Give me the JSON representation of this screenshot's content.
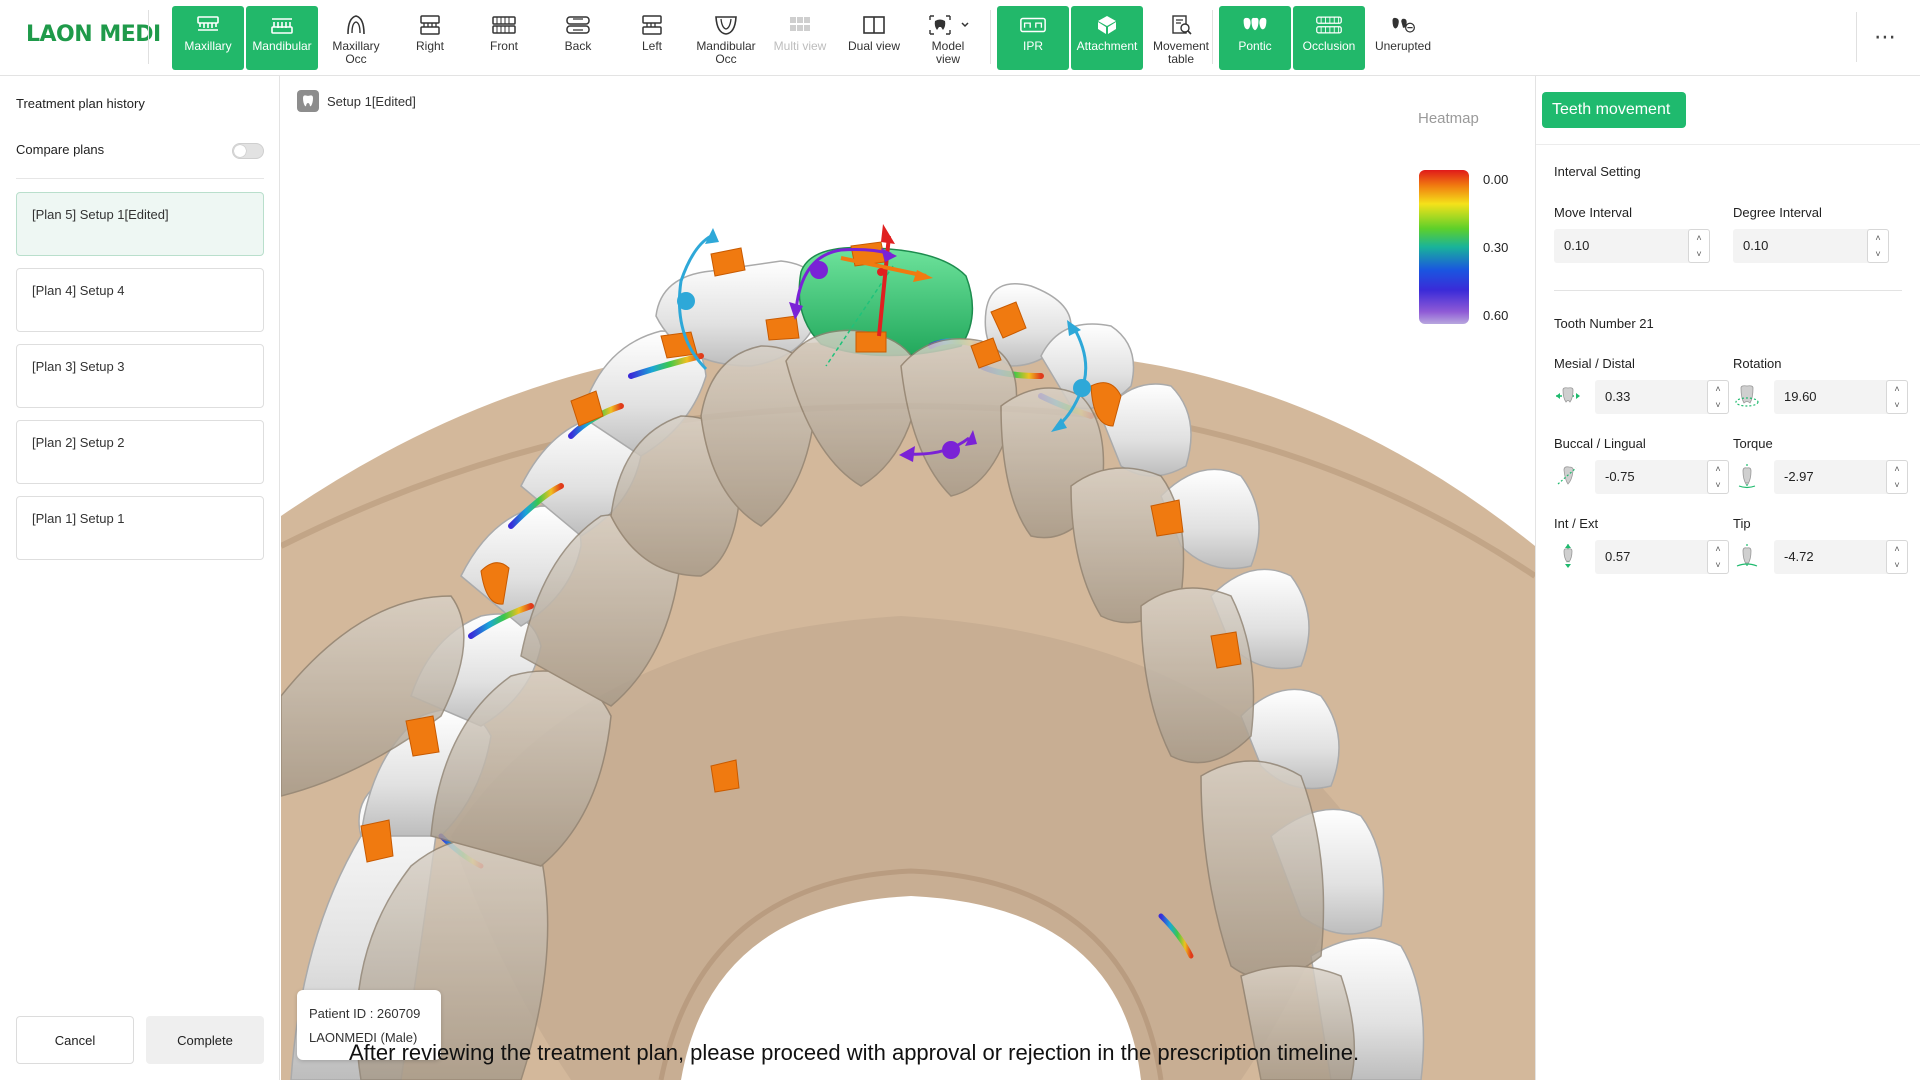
{
  "app": {
    "logo": "LAON MEDI"
  },
  "toolbar": {
    "buttons": [
      {
        "id": "maxillary",
        "label": "Maxillary",
        "active": true
      },
      {
        "id": "mandibular",
        "label": "Mandibular",
        "active": true
      },
      {
        "id": "maxillary-occ",
        "label": "Maxillary\nOcc",
        "active": false
      },
      {
        "id": "right",
        "label": "Right",
        "active": false
      },
      {
        "id": "front",
        "label": "Front",
        "active": false
      },
      {
        "id": "back",
        "label": "Back",
        "active": false
      },
      {
        "id": "left",
        "label": "Left",
        "active": false
      },
      {
        "id": "mandibular-occ",
        "label": "Mandibular\nOcc",
        "active": false
      },
      {
        "id": "multi-view",
        "label": "Multi view",
        "active": false,
        "disabled": true
      },
      {
        "id": "dual-view",
        "label": "Dual view",
        "active": false
      },
      {
        "id": "model-view",
        "label": "Model\nview",
        "active": false
      },
      {
        "id": "ipr",
        "label": "IPR",
        "active": true
      },
      {
        "id": "attachment",
        "label": "Attachment",
        "active": true
      },
      {
        "id": "movement-table",
        "label": "Movement\ntable",
        "active": false
      },
      {
        "id": "pontic",
        "label": "Pontic",
        "active": true
      },
      {
        "id": "occlusion",
        "label": "Occlusion",
        "active": true
      },
      {
        "id": "unerupted",
        "label": "Unerupted",
        "active": false
      }
    ],
    "more_label": "⋯"
  },
  "sidebar": {
    "title": "Treatment plan history",
    "compare_label": "Compare plans",
    "compare_on": false,
    "plans": [
      {
        "label": "[Plan 5] Setup 1[Edited]",
        "selected": true
      },
      {
        "label": "[Plan 4] Setup 4",
        "selected": false
      },
      {
        "label": "[Plan 3] Setup 3",
        "selected": false
      },
      {
        "label": "[Plan 2] Setup 2",
        "selected": false
      },
      {
        "label": "[Plan 1] Setup 1",
        "selected": false
      }
    ],
    "cancel_label": "Cancel",
    "complete_label": "Complete"
  },
  "viewport": {
    "setup_label": "Setup 1[Edited]",
    "patient_id": "Patient ID : 260709",
    "patient_name": "LAONMEDI (Male)",
    "notice": "After reviewing the treatment plan, please proceed with approval or rejection in the prescription timeline.",
    "heatmap": {
      "tab_label": "Heatmap",
      "labels": [
        "0.00",
        "0.30",
        "0.60"
      ]
    }
  },
  "panel": {
    "tab_label": "Teeth movement",
    "tab_ghost": "ment",
    "interval_title": "Interval Setting",
    "move_interval_label": "Move Interval",
    "move_interval_value": "0.10",
    "degree_interval_label": "Degree Interval",
    "degree_interval_value": "0.10",
    "tooth_number": "Tooth Number 21",
    "fields": {
      "mesial_distal": {
        "label": "Mesial / Distal",
        "value": "0.33"
      },
      "rotation": {
        "label": "Rotation",
        "value": "19.60"
      },
      "buccal_lingual": {
        "label": "Buccal / Lingual",
        "value": "-0.75"
      },
      "torque": {
        "label": "Torque",
        "value": "-2.97"
      },
      "int_ext": {
        "label": "Int / Ext",
        "value": "0.57"
      },
      "tip": {
        "label": "Tip",
        "value": "-4.72"
      }
    }
  },
  "colors": {
    "accent": "#22b86a",
    "attachment": "#f07a10",
    "gum": "#c8ae93",
    "selected_tooth": "#3cc878"
  }
}
